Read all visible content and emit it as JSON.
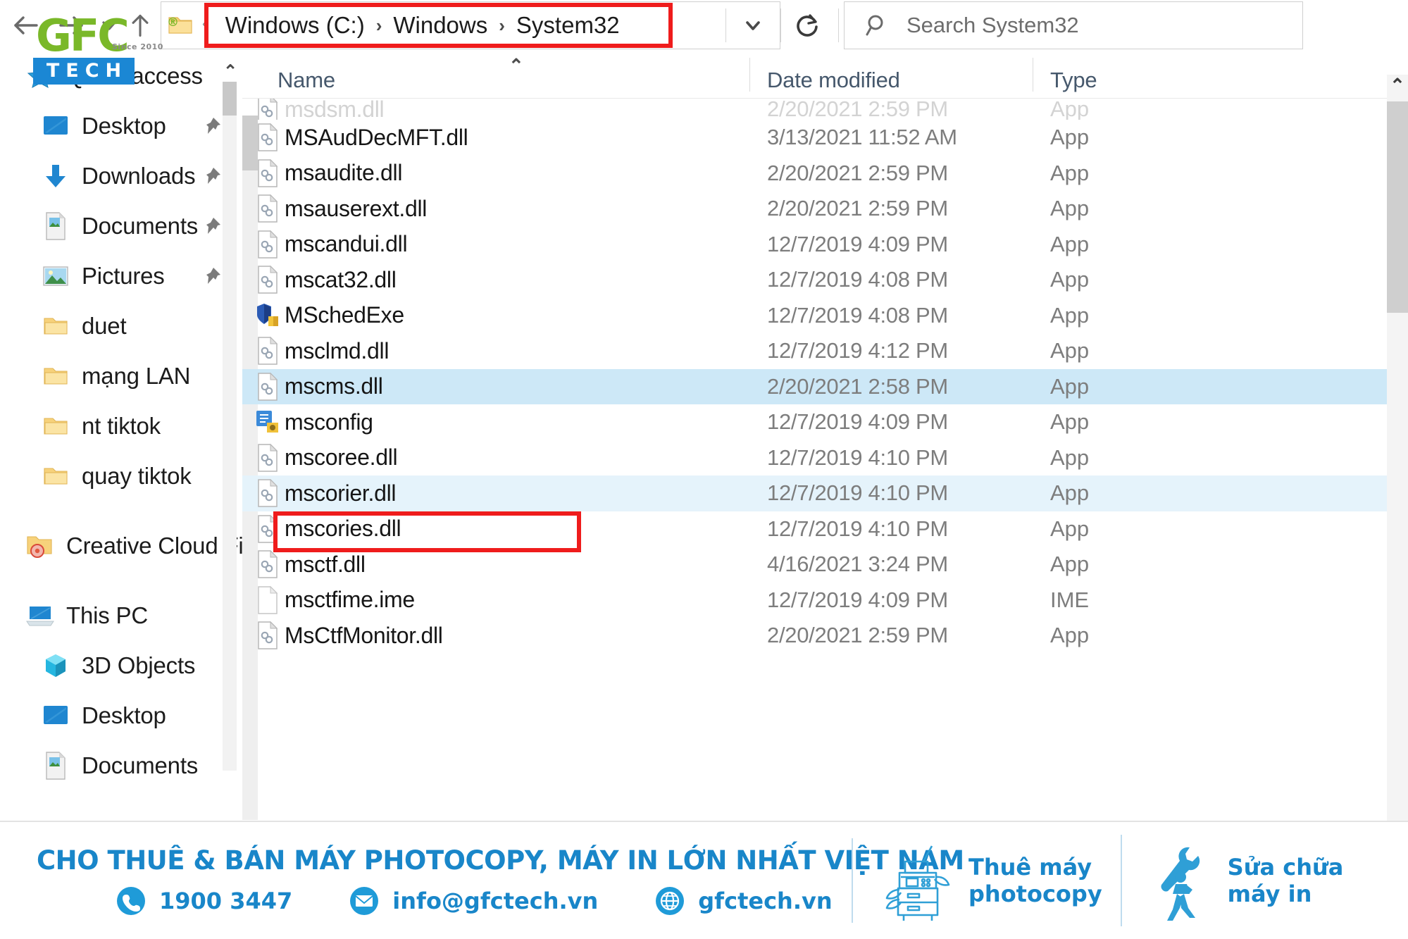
{
  "toolbar": {
    "back_title": "Back",
    "forward_title": "Forward",
    "recent_title": "Recent locations",
    "up_title": "Up",
    "address": {
      "crumbs": [
        "Windows (C:)",
        "Windows",
        "System32"
      ],
      "separator": "›",
      "chevron_left": "‹",
      "dropdown_glyph": "⌄",
      "refresh_glyph": "↻"
    },
    "search": {
      "placeholder": "Search System32"
    }
  },
  "logo": {
    "word": "GFC",
    "registered": "®",
    "since": "Since 2010",
    "tech": "TECH"
  },
  "sidebar": {
    "scroll_up_glyph": "⌃",
    "groups": [
      {
        "items": [
          {
            "label": "Quick access",
            "icon": "star-icon",
            "pinned": false,
            "indent": false
          },
          {
            "label": "Desktop",
            "icon": "desktop-icon",
            "pinned": true,
            "indent": true
          },
          {
            "label": "Downloads",
            "icon": "download-icon",
            "pinned": true,
            "indent": true
          },
          {
            "label": "Documents",
            "icon": "documents-icon",
            "pinned": true,
            "indent": true
          },
          {
            "label": "Pictures",
            "icon": "pictures-icon",
            "pinned": true,
            "indent": true
          },
          {
            "label": "duet",
            "icon": "folder-icon",
            "pinned": false,
            "indent": true
          },
          {
            "label": "mạng LAN",
            "icon": "folder-icon",
            "pinned": false,
            "indent": true
          },
          {
            "label": "nt tiktok",
            "icon": "folder-icon",
            "pinned": false,
            "indent": true
          },
          {
            "label": "quay tiktok",
            "icon": "folder-icon",
            "pinned": false,
            "indent": true
          }
        ]
      },
      {
        "items": [
          {
            "label": "Creative Cloud File",
            "icon": "creative-cloud-icon",
            "pinned": false,
            "indent": false
          }
        ]
      },
      {
        "items": [
          {
            "label": "This PC",
            "icon": "this-pc-icon",
            "pinned": false,
            "indent": false
          },
          {
            "label": "3D Objects",
            "icon": "3d-objects-icon",
            "pinned": false,
            "indent": true
          },
          {
            "label": "Desktop",
            "icon": "desktop-icon",
            "pinned": false,
            "indent": true
          },
          {
            "label": "Documents",
            "icon": "documents-icon",
            "pinned": false,
            "indent": true
          }
        ]
      }
    ]
  },
  "filepane": {
    "sort_indicator": "⌃",
    "scroll_up_glyph": "⌃",
    "columns": [
      {
        "key": "name",
        "label": "Name"
      },
      {
        "key": "date",
        "label": "Date modified"
      },
      {
        "key": "type",
        "label": "Type"
      }
    ],
    "rows": [
      {
        "name": "msdsm.dll",
        "date": "2/20/2021 2:59 PM",
        "type": "App",
        "icon": "dll-icon",
        "state": "clipped"
      },
      {
        "name": "MSAudDecMFT.dll",
        "date": "3/13/2021 11:52 AM",
        "type": "App",
        "icon": "dll-icon",
        "state": "normal"
      },
      {
        "name": "msaudite.dll",
        "date": "2/20/2021 2:59 PM",
        "type": "App",
        "icon": "dll-icon",
        "state": "normal"
      },
      {
        "name": "msauserext.dll",
        "date": "2/20/2021 2:59 PM",
        "type": "App",
        "icon": "dll-icon",
        "state": "normal"
      },
      {
        "name": "mscandui.dll",
        "date": "12/7/2019 4:09 PM",
        "type": "App",
        "icon": "dll-icon",
        "state": "normal"
      },
      {
        "name": "mscat32.dll",
        "date": "12/7/2019 4:08 PM",
        "type": "App",
        "icon": "dll-icon",
        "state": "normal"
      },
      {
        "name": "MSchedExe",
        "date": "12/7/2019 4:08 PM",
        "type": "App",
        "icon": "exe-shield-icon",
        "state": "normal"
      },
      {
        "name": "msclmd.dll",
        "date": "12/7/2019 4:12 PM",
        "type": "App",
        "icon": "dll-icon",
        "state": "normal"
      },
      {
        "name": "mscms.dll",
        "date": "2/20/2021 2:58 PM",
        "type": "App",
        "icon": "dll-icon",
        "state": "selected"
      },
      {
        "name": "msconfig",
        "date": "12/7/2019 4:09 PM",
        "type": "App",
        "icon": "msconfig-icon",
        "state": "normal"
      },
      {
        "name": "mscoree.dll",
        "date": "12/7/2019 4:10 PM",
        "type": "App",
        "icon": "dll-icon",
        "state": "normal"
      },
      {
        "name": "mscorier.dll",
        "date": "12/7/2019 4:10 PM",
        "type": "App",
        "icon": "dll-icon",
        "state": "hover"
      },
      {
        "name": "mscories.dll",
        "date": "12/7/2019 4:10 PM",
        "type": "App",
        "icon": "dll-icon",
        "state": "normal"
      },
      {
        "name": "msctf.dll",
        "date": "4/16/2021 3:24 PM",
        "type": "App",
        "icon": "dll-icon",
        "state": "normal"
      },
      {
        "name": "msctfime.ime",
        "date": "12/7/2019 4:09 PM",
        "type": "IME",
        "icon": "blank-file-icon",
        "state": "normal"
      },
      {
        "name": "MsCtfMonitor.dll",
        "date": "2/20/2021 2:59 PM",
        "type": "App",
        "icon": "dll-icon",
        "state": "normal"
      }
    ]
  },
  "banner": {
    "title": "CHO THUÊ & BÁN MÁY PHOTOCOPY, MÁY IN LỚN NHẤT VIỆT NAM",
    "contacts": [
      {
        "icon": "phone-icon",
        "text": "1900 3447"
      },
      {
        "icon": "email-icon",
        "text": "info@gfctech.vn"
      },
      {
        "icon": "globe-icon",
        "text": "gfctech.vn"
      }
    ],
    "services": [
      {
        "icon": "photocopier-icon",
        "line1": "Thuê máy",
        "line2": "photocopy"
      },
      {
        "icon": "repairman-icon",
        "line1": "Sửa chữa",
        "line2": "máy in"
      }
    ],
    "accent_color": "#1986c9"
  },
  "highlights": {
    "address_box_color": "#ef1c1c",
    "row_box_color": "#ef1c1c",
    "selected_row_color": "#cde8f7"
  }
}
